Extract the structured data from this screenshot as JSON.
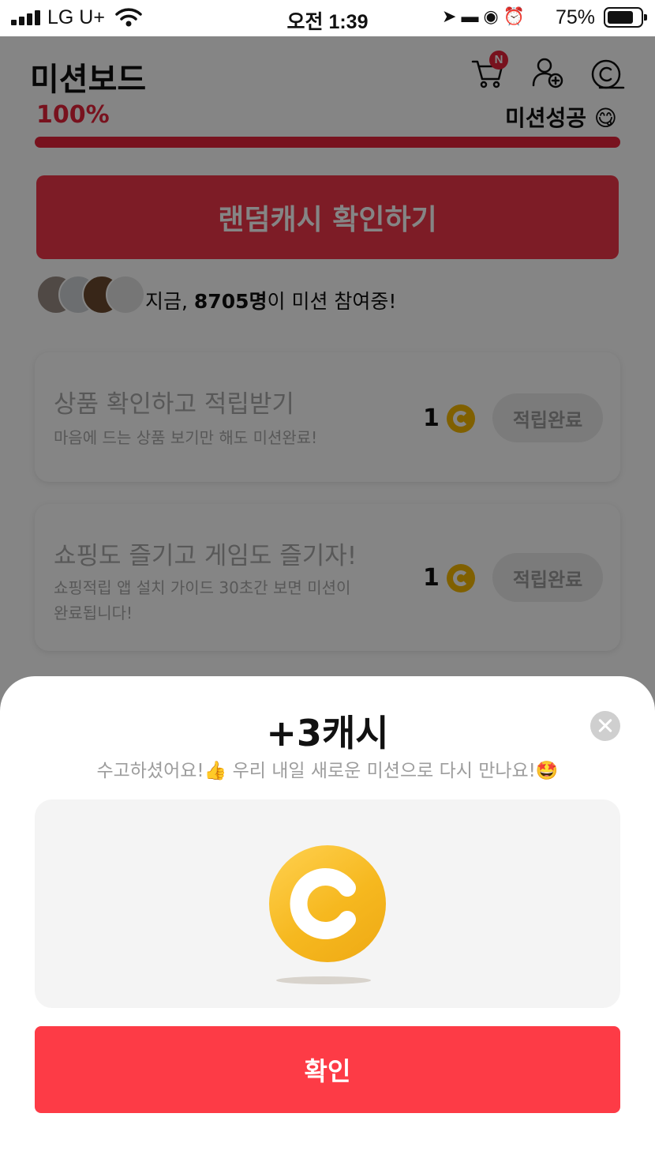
{
  "status_bar": {
    "carrier": "LG U+",
    "time": "오전 1:39",
    "battery": "75%",
    "icons": [
      "signal-icon",
      "wifi-icon",
      "location-icon",
      "sleep-icon",
      "rotation-lock-icon",
      "alarm-icon",
      "battery-icon"
    ]
  },
  "header": {
    "title": "미션보드",
    "cart_badge": "N",
    "icons": [
      "cart-icon",
      "add-friend-icon",
      "cash-icon"
    ]
  },
  "progress": {
    "percent_label": "100%",
    "fraction": 1.0,
    "status_label": "미션성공 😋"
  },
  "random_cash_button": "랜덤캐시 확인하기",
  "participants": {
    "prefix": "지금, ",
    "count": "8705명",
    "suffix": "이 미션 참여중!"
  },
  "missions": [
    {
      "title": "상품 확인하고 적립받기",
      "description": "마음에 드는 상품 보기만 해도 미션완료!",
      "reward": "1",
      "button": "적립완료"
    },
    {
      "title": "쇼핑도 즐기고 게임도 즐기자!",
      "description": "쇼핑적립 앱 설치 가이드 30초간 보면 미션이 완료됩니다!",
      "reward": "1",
      "button": "적립완료"
    }
  ],
  "modal": {
    "title": "+3캐시",
    "subtitle": "수고하셨어요!👍 우리 내일 새로운 미션으로 다시 만나요!🤩",
    "confirm": "확인"
  },
  "colors": {
    "accent": "#fd3b46",
    "coin": "#f6b81f",
    "overlay": "rgba(0,0,0,0.48)"
  }
}
